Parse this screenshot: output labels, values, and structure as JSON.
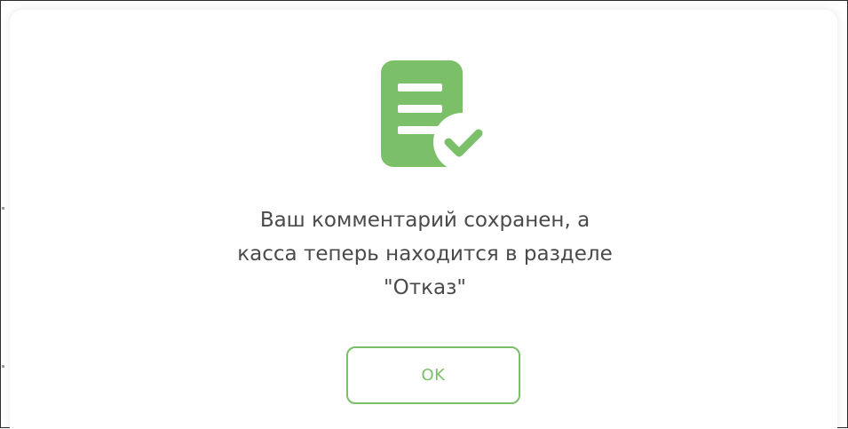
{
  "dialog": {
    "message_lines": [
      "Ваш комментарий сохранен, а",
      "касса теперь находится в разделе",
      "\"Отказ\""
    ],
    "ok_label": "OK",
    "icon": "document-check-icon",
    "accent_color": "#7cbf69",
    "icon_color": "#7cbf69"
  }
}
